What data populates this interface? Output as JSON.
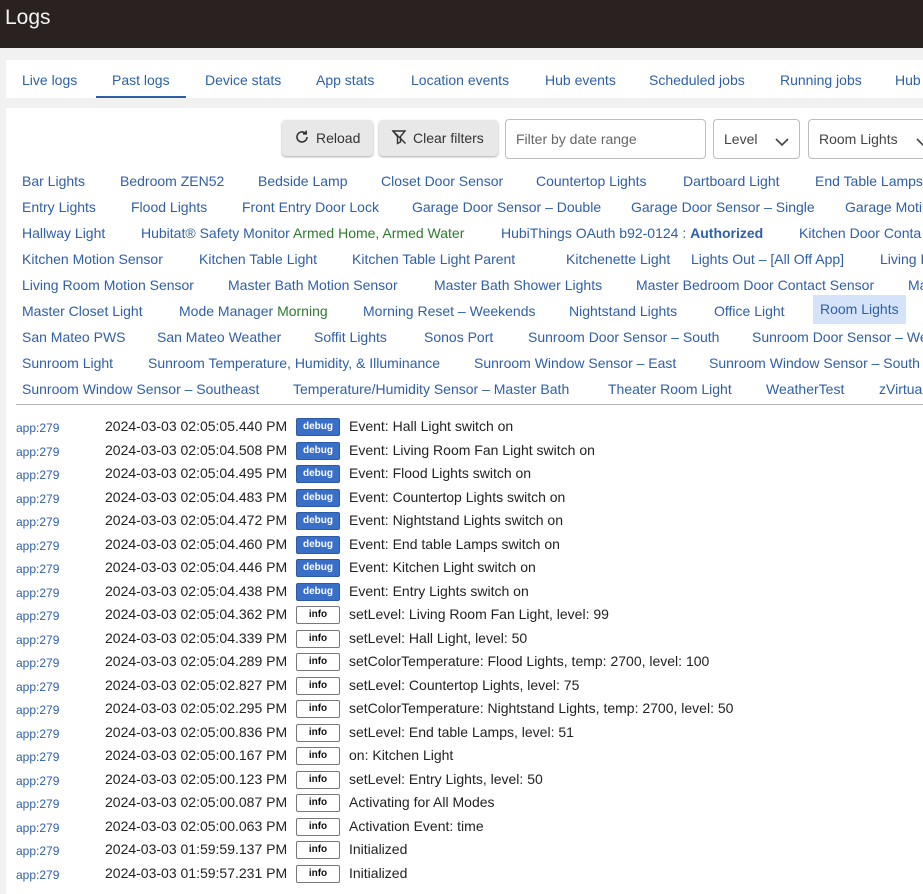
{
  "window": {
    "title": "Logs"
  },
  "tabs": [
    {
      "label": "Live logs"
    },
    {
      "label": "Past logs"
    },
    {
      "label": "Device stats"
    },
    {
      "label": "App stats"
    },
    {
      "label": "Location events"
    },
    {
      "label": "Hub events"
    },
    {
      "label": "Scheduled jobs"
    },
    {
      "label": "Running jobs"
    },
    {
      "label": "Hub"
    }
  ],
  "toolbar": {
    "reload_label": "Reload",
    "clear_filters_label": "Clear filters",
    "date_placeholder": "Filter by date range",
    "level_value": "Level",
    "device_value": "Room Lights"
  },
  "devices": [
    {
      "label": "Bar Lights"
    },
    {
      "label": "Bedroom ZEN52"
    },
    {
      "label": "Bedside Lamp"
    },
    {
      "label": "Closet Door Sensor"
    },
    {
      "label": "Countertop Lights"
    },
    {
      "label": "Dartboard Light"
    },
    {
      "label": "End Table Lamps"
    },
    {
      "label": "Entry Lights"
    },
    {
      "label": "Flood Lights"
    },
    {
      "label": "Front Entry Door Lock"
    },
    {
      "label": "Garage Door Sensor – Double"
    },
    {
      "label": "Garage Door Sensor – Single"
    },
    {
      "label": "Garage Moti"
    },
    {
      "label": "Hallway Light"
    },
    {
      "label": "Hubitat® Safety Monitor",
      "status": "Armed Home, Armed Water"
    },
    {
      "label": "HubiThings OAuth b92-0124 :",
      "badge": "Authorized"
    },
    {
      "label": "Kitchen Door Conta"
    },
    {
      "label": "Kitchen Motion Sensor"
    },
    {
      "label": "Kitchen Table Light"
    },
    {
      "label": "Kitchen Table Light Parent"
    },
    {
      "label": "Kitchenette Light"
    },
    {
      "label": "Lights Out – [All Off App]"
    },
    {
      "label": "Living R"
    },
    {
      "label": "Living Room Motion Sensor"
    },
    {
      "label": "Master Bath Motion Sensor"
    },
    {
      "label": "Master Bath Shower Lights"
    },
    {
      "label": "Master Bedroom Door Contact Sensor"
    },
    {
      "label": "Ma"
    },
    {
      "label": "Master Closet Light"
    },
    {
      "label": "Mode Manager",
      "status": "Morning"
    },
    {
      "label": "Morning Reset – Weekends"
    },
    {
      "label": "Nightstand Lights"
    },
    {
      "label": "Office Light"
    },
    {
      "label": "Room Lights"
    },
    {
      "label": "San Mateo PWS"
    },
    {
      "label": "San Mateo Weather"
    },
    {
      "label": "Soffit Lights"
    },
    {
      "label": "Sonos Port"
    },
    {
      "label": "Sunroom Door Sensor – South"
    },
    {
      "label": "Sunroom Door Sensor – We"
    },
    {
      "label": "Sunroom Light"
    },
    {
      "label": "Sunroom Temperature, Humidity, & Illuminance"
    },
    {
      "label": "Sunroom Window Sensor – East"
    },
    {
      "label": "Sunroom Window Sensor – South"
    },
    {
      "label": "Sunroom Window Sensor – Southeast"
    },
    {
      "label": "Temperature/Humidity Sensor – Master Bath"
    },
    {
      "label": "Theater Room Light"
    },
    {
      "label": "WeatherTest"
    },
    {
      "label": "zVirtua"
    }
  ],
  "logs": [
    {
      "source": "app:279",
      "time": "2024-03-03 02:05:05.440 PM",
      "level": "debug",
      "message": "Event: Hall Light switch on"
    },
    {
      "source": "app:279",
      "time": "2024-03-03 02:05:04.508 PM",
      "level": "debug",
      "message": "Event: Living Room Fan Light switch on"
    },
    {
      "source": "app:279",
      "time": "2024-03-03 02:05:04.495 PM",
      "level": "debug",
      "message": "Event: Flood Lights switch on"
    },
    {
      "source": "app:279",
      "time": "2024-03-03 02:05:04.483 PM",
      "level": "debug",
      "message": "Event: Countertop Lights switch on"
    },
    {
      "source": "app:279",
      "time": "2024-03-03 02:05:04.472 PM",
      "level": "debug",
      "message": "Event: Nightstand Lights switch on"
    },
    {
      "source": "app:279",
      "time": "2024-03-03 02:05:04.460 PM",
      "level": "debug",
      "message": "Event: End table Lamps switch on"
    },
    {
      "source": "app:279",
      "time": "2024-03-03 02:05:04.446 PM",
      "level": "debug",
      "message": "Event: Kitchen Light switch on"
    },
    {
      "source": "app:279",
      "time": "2024-03-03 02:05:04.438 PM",
      "level": "debug",
      "message": "Event: Entry Lights switch on"
    },
    {
      "source": "app:279",
      "time": "2024-03-03 02:05:04.362 PM",
      "level": "info",
      "message": "setLevel: Living Room Fan Light, level: 99"
    },
    {
      "source": "app:279",
      "time": "2024-03-03 02:05:04.339 PM",
      "level": "info",
      "message": "setLevel: Hall Light, level: 50"
    },
    {
      "source": "app:279",
      "time": "2024-03-03 02:05:04.289 PM",
      "level": "info",
      "message": "setColorTemperature: Flood Lights, temp: 2700, level: 100"
    },
    {
      "source": "app:279",
      "time": "2024-03-03 02:05:02.827 PM",
      "level": "info",
      "message": "setLevel: Countertop Lights, level: 75"
    },
    {
      "source": "app:279",
      "time": "2024-03-03 02:05:02.295 PM",
      "level": "info",
      "message": "setColorTemperature: Nightstand Lights, temp: 2700, level: 50"
    },
    {
      "source": "app:279",
      "time": "2024-03-03 02:05:00.836 PM",
      "level": "info",
      "message": "setLevel: End table Lamps, level: 51"
    },
    {
      "source": "app:279",
      "time": "2024-03-03 02:05:00.167 PM",
      "level": "info",
      "message": "on: Kitchen Light"
    },
    {
      "source": "app:279",
      "time": "2024-03-03 02:05:00.123 PM",
      "level": "info",
      "message": "setLevel: Entry Lights, level: 50"
    },
    {
      "source": "app:279",
      "time": "2024-03-03 02:05:00.087 PM",
      "level": "info",
      "message": "Activating for All Modes"
    },
    {
      "source": "app:279",
      "time": "2024-03-03 02:05:00.063 PM",
      "level": "info",
      "message": "Activation Event: time"
    },
    {
      "source": "app:279",
      "time": "2024-03-03 01:59:59.137 PM",
      "level": "info",
      "message": "Initialized"
    },
    {
      "source": "app:279",
      "time": "2024-03-03 01:59:57.231 PM",
      "level": "info",
      "message": "Initialized"
    }
  ]
}
